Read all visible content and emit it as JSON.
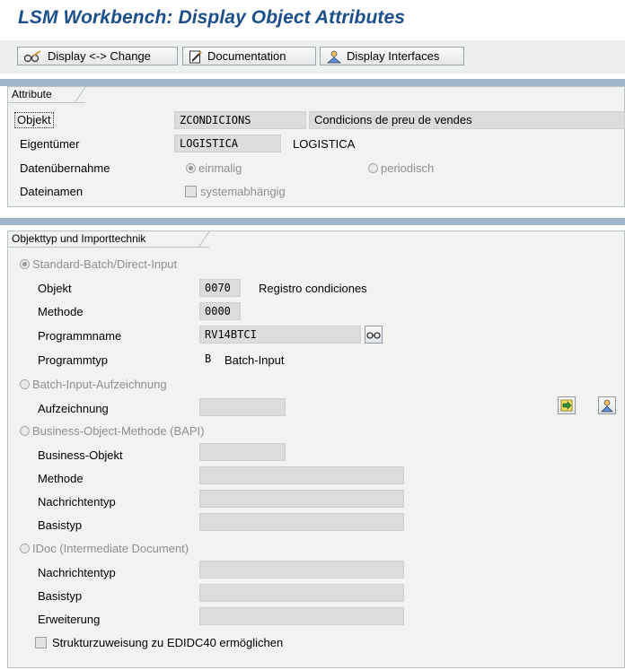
{
  "app": {
    "title": "LSM Workbench: Display Object Attributes"
  },
  "toolbar": {
    "display_change": "Display <-> Change",
    "documentation": "Documentation",
    "display_interfaces": "Display Interfaces"
  },
  "attribute": {
    "tab": "Attribute",
    "objekt_label": "Objekt",
    "objekt_value": "ZCONDICIONS",
    "objekt_desc": "Condicions de preu de vendes",
    "owner_label": "Eigentümer",
    "owner_value": "LOGISTICA",
    "owner_desc": "LOGISTICA",
    "transfer_label": "Datenübernahme",
    "transfer_once": "einmalig",
    "transfer_periodic": "periodisch",
    "filenames_label": "Dateinamen",
    "filenames_option": "systemabhängig"
  },
  "import": {
    "tab": "Objekttyp und Importtechnik",
    "standard_batch": "Standard-Batch/Direct-Input",
    "objekt_label": "Objekt",
    "objekt_value": "0070",
    "objekt_desc": "Registro condiciones",
    "method_label": "Methode",
    "method_value": "0000",
    "program_label": "Programmname",
    "program_value": "RV14BTCI",
    "progtype_label": "Programmtyp",
    "progtype_value": "B",
    "progtype_desc": "Batch-Input",
    "batch_recording": "Batch-Input-Aufzeichnung",
    "recording_label": "Aufzeichnung",
    "recording_value": "",
    "bapi": "Business-Object-Methode (BAPI)",
    "bo_label": "Business-Objekt",
    "bo_value": "",
    "bapi_method_label": "Methode",
    "bapi_method_value": "",
    "bapi_msgtype_label": "Nachrichtentyp",
    "bapi_msgtype_value": "",
    "bapi_basetype_label": "Basistyp",
    "bapi_basetype_value": "",
    "idoc": "IDoc (Intermediate Document)",
    "idoc_msgtype_label": "Nachrichtentyp",
    "idoc_msgtype_value": "",
    "idoc_basetype_label": "Basistyp",
    "idoc_basetype_value": "",
    "extension_label": "Erweiterung",
    "extension_value": "",
    "structure_assign": "Strukturzuweisung zu EDIDC40 ermöglichen"
  },
  "colors": {
    "title": "#1d4f8a",
    "band": "#9fb6ca",
    "frame_bg": "#f2f2f1"
  }
}
